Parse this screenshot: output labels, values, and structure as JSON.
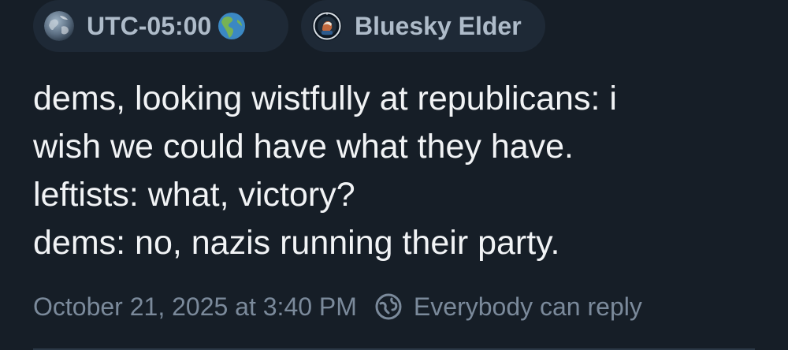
{
  "badges": {
    "timezone": {
      "label": "UTC-05:00",
      "avatar_icon": "earth-globe-icon",
      "trailing_emoji": "globe-americas-icon"
    },
    "community": {
      "label": "Bluesky Elder",
      "avatar_icon": "elder-badge-icon"
    }
  },
  "post": {
    "lines": [
      "dems, looking wistfully at republicans: i",
      "wish we could have what they have.",
      "leftists: what, victory?",
      "dems: no, nazis running their party."
    ]
  },
  "meta": {
    "timestamp": "October 21, 2025 at 3:40 PM",
    "reply_setting": "Everybody can reply",
    "reply_icon": "globe-reply-icon"
  },
  "colors": {
    "background": "#161e27",
    "badge_background": "#1e2936",
    "badge_text": "#aebbc9",
    "post_text": "#f1f3f5",
    "meta_text": "#7b8a9b"
  }
}
